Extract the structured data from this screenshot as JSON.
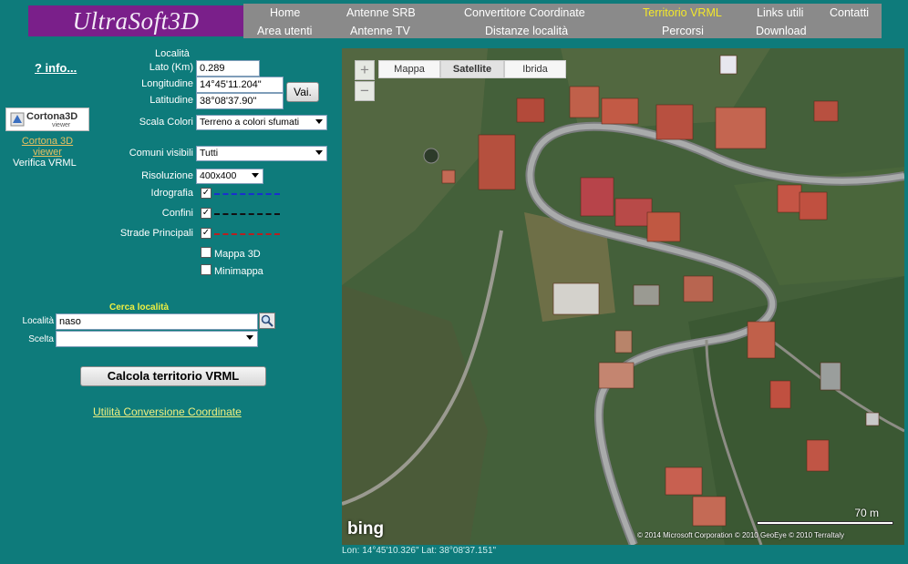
{
  "header": {
    "logo_text": "UltraSoft3D",
    "nav_row1": [
      "Home",
      "Antenne SRB",
      "Convertitore Coordinate",
      "Territorio VRML",
      "Links utili",
      "Contatti"
    ],
    "nav_row2": [
      "Area utenti",
      "Antenne TV",
      "Distanze località",
      "Percorsi",
      "Download"
    ],
    "active_item": "Territorio VRML"
  },
  "left": {
    "info_link": "? info...",
    "cortona": {
      "logo_text": "Cortona3D",
      "logo_sub": "viewer",
      "link": "Cortona 3D viewer",
      "verify": "Verifica VRML"
    },
    "localita_title": "Località",
    "lato_label": "Lato (Km)",
    "lato_value": "0.289",
    "longitudine_label": "Longitudine",
    "longitudine_value": "14°45'11.204\"",
    "latitudine_label": "Latitudine",
    "latitudine_value": "38°08'37.90\"",
    "vai_button": "Vai.",
    "scala_label": "Scala Colori",
    "scala_value": "Terreno a colori sfumati",
    "comuni_label": "Comuni  visibili",
    "comuni_value": "Tutti",
    "risoluzione_label": "Risoluzione",
    "risoluzione_value": "400x400",
    "idrografia_label": "Idrografia",
    "confini_label": "Confini",
    "strade_label": "Strade Principali",
    "mappa3d_label": "Mappa 3D",
    "minimappa_label": "Minimappa",
    "cerca_title": "Cerca località",
    "localita_search_label": "Località",
    "localita_search_value": "naso",
    "scelta_label": "Scelta",
    "scelta_value": "",
    "calcola_button": "Calcola territorio VRML",
    "utilita_link": "Utilità Conversione Coordinate",
    "colors": {
      "idrografia": "#1a2fd0",
      "confini": "#111111",
      "strade": "#b82020"
    }
  },
  "map": {
    "tabs": [
      "Mappa",
      "Satellite",
      "Ibrida"
    ],
    "active_tab": "Satellite",
    "zoom_in": "+",
    "zoom_out": "−",
    "scale": "70 m",
    "brand": "bing",
    "copyright": "© 2014 Microsoft Corporation   © 2010 GeoEye   © 2010 TerraItaly"
  },
  "coords_text": "Lon: 14°45'10.326\" Lat: 38°08'37.151\""
}
